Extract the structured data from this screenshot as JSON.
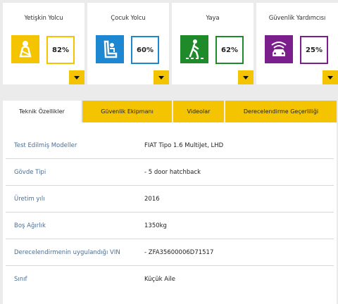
{
  "categories": [
    {
      "title": "Yetişkin Yolcu",
      "percent": "82%",
      "icon": "adult-occupant-icon",
      "color": "#f5c400"
    },
    {
      "title": "Çocuk Yolcu",
      "percent": "60%",
      "icon": "child-seat-icon",
      "color": "#1e87d2"
    },
    {
      "title": "Yaya",
      "percent": "62%",
      "icon": "pedestrian-icon",
      "color": "#1f8a2a"
    },
    {
      "title": "Güvenlik Yardımcısı",
      "percent": "25%",
      "icon": "safety-assist-icon",
      "color": "#7a1f8c"
    }
  ],
  "tabs": [
    "Teknik Özellikler",
    "Güvenlik Ekipmanı",
    "Videolar",
    "Derecelendirme Geçerliliği"
  ],
  "active_tab": "Teknik Özellikler",
  "details": [
    {
      "label": "Test Edilmiş Modeller",
      "value": "FIAT Tipo 1.6 MultiJet, LHD"
    },
    {
      "label": "Gövde Tipi",
      "value": "- 5 door hatchback"
    },
    {
      "label": "Üretim yılı",
      "value": "2016"
    },
    {
      "label": "Boş Ağırlık",
      "value": "1350kg"
    },
    {
      "label": "Derecelendirmenin uygulandığı VIN",
      "value": "- ZFA35600006D71517"
    },
    {
      "label": "Sınıf",
      "value": "Küçük Aile"
    }
  ]
}
